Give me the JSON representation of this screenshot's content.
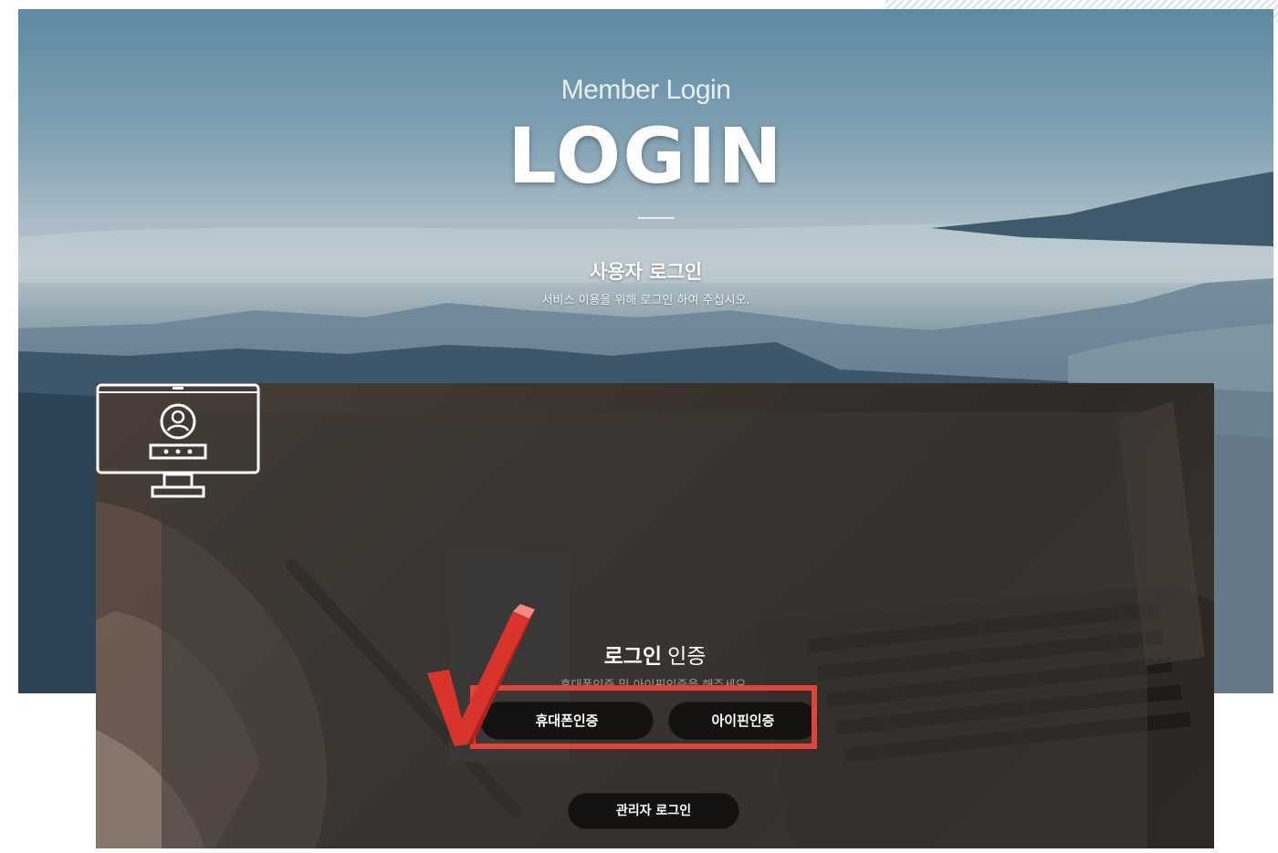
{
  "hero": {
    "subtitle": "Member Login",
    "title": "LOGIN",
    "section_title": "사용자 로그인",
    "section_desc": "서비스 이용을 위해 로그인 하여 주십시오."
  },
  "auth": {
    "title_bold": "로그인",
    "title_light": "인증",
    "desc": "휴대폰인증 및 아이핀인증을 해주세요.",
    "phone_button": "휴대폰인증",
    "ipin_button": "아이핀인증",
    "admin_button": "관리자 로그인"
  },
  "colors": {
    "highlight": "#e4413a",
    "button_bg": "#141210",
    "checkmark": "#d9342b"
  },
  "icons": [
    "monitor-user-icon",
    "checkmark-icon"
  ]
}
